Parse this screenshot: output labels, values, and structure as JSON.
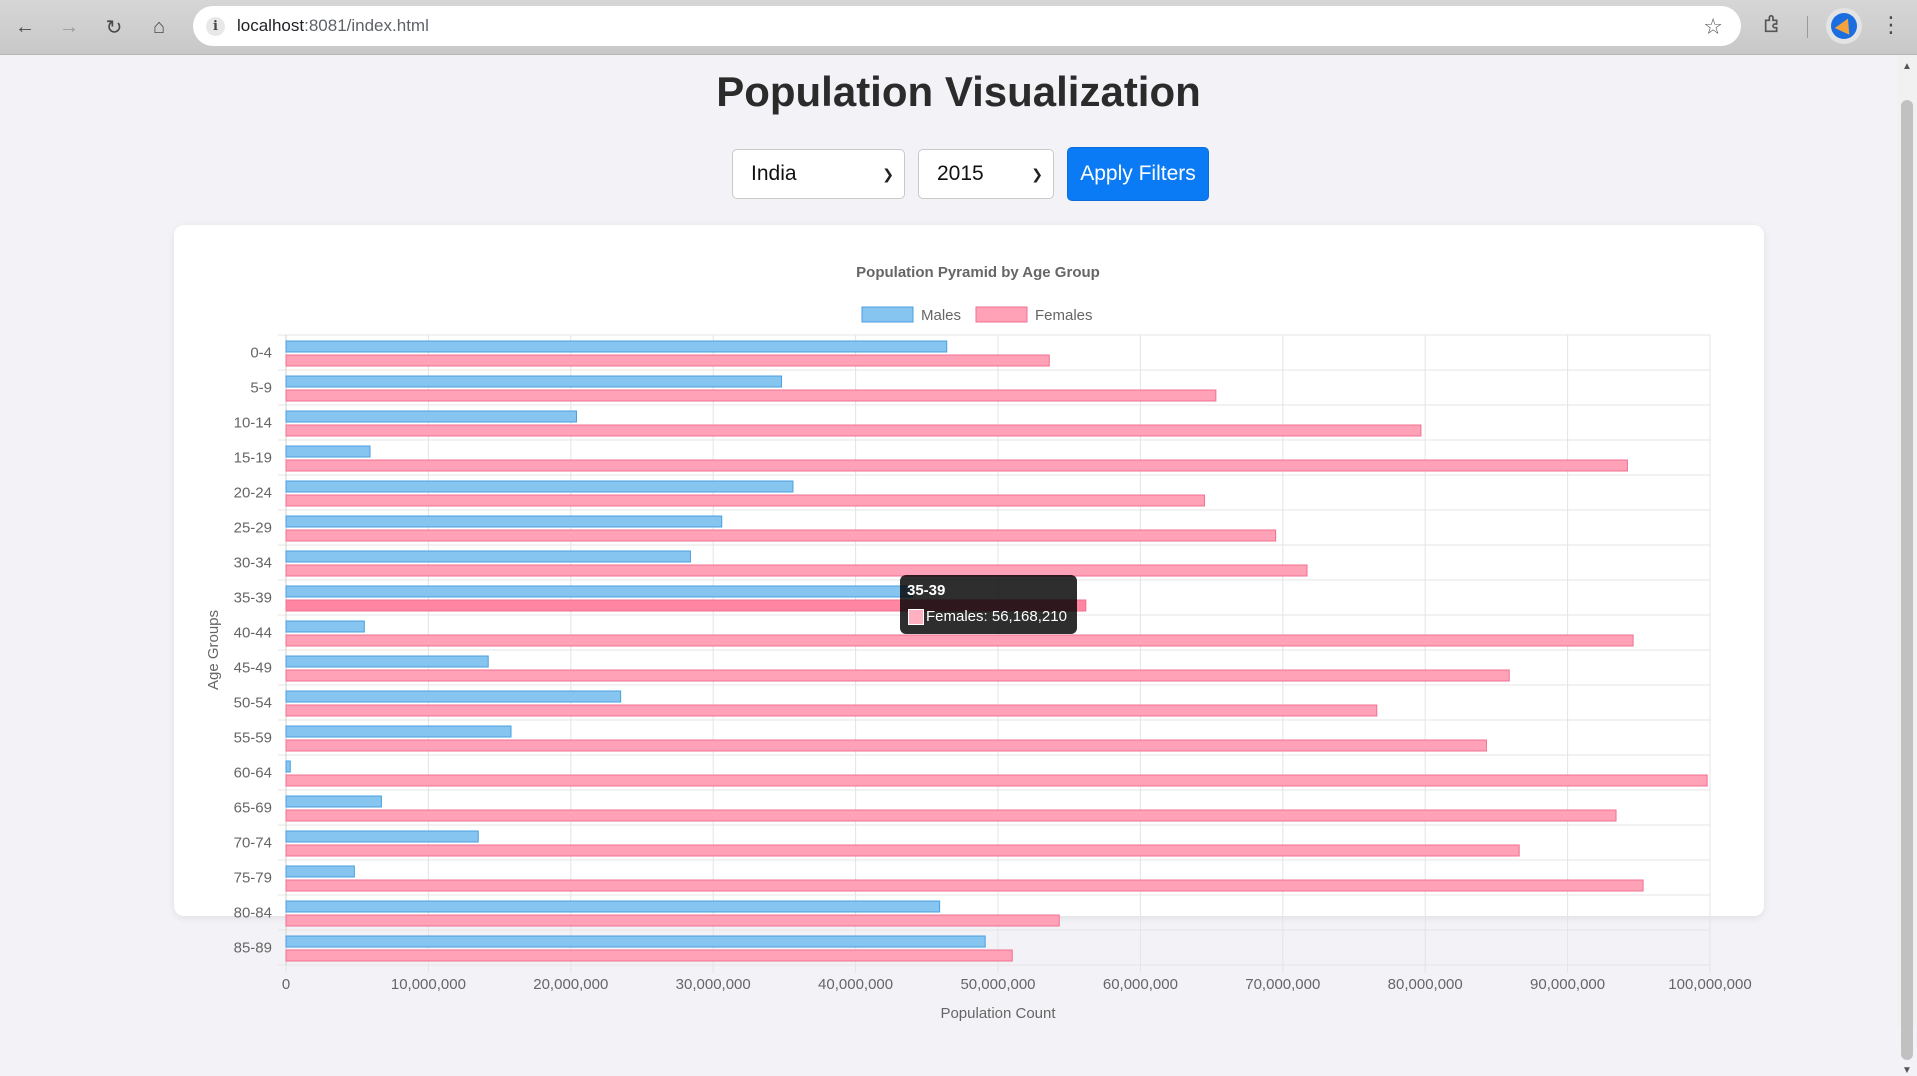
{
  "browser": {
    "url_host": "localhost",
    "url_rest": ":8081/index.html"
  },
  "page": {
    "title": "Population Visualization",
    "country_select": "India",
    "year_select": "2015",
    "apply_button": "Apply Filters"
  },
  "tooltip": {
    "title": "35-39",
    "label": "Females: 56,168,210"
  },
  "colors": {
    "males_fill": "#86c5f0",
    "males_border": "#4a9fe0",
    "females_fill": "#ffa2b8",
    "females_border": "#f0708f",
    "accent_button": "#0a7bf5"
  },
  "chart_data": {
    "type": "bar",
    "orientation": "horizontal",
    "title": "Population Pyramid by Age Group",
    "xlabel": "Population Count",
    "ylabel": "Age Groups",
    "xlim": [
      0,
      100000000
    ],
    "x_ticks": [
      "0",
      "10,000,000",
      "20,000,000",
      "30,000,000",
      "40,000,000",
      "50,000,000",
      "60,000,000",
      "70,000,000",
      "80,000,000",
      "90,000,000",
      "100,000,000"
    ],
    "legend_position": "top",
    "grid": true,
    "categories": [
      "0-4",
      "5-9",
      "10-14",
      "15-19",
      "20-24",
      "25-29",
      "30-34",
      "35-39",
      "40-44",
      "45-49",
      "50-54",
      "55-59",
      "60-64",
      "65-69",
      "70-74",
      "75-79",
      "80-84",
      "85-89"
    ],
    "series": [
      {
        "name": "Males",
        "values": [
          46400000,
          34800000,
          20400000,
          5900000,
          35600000,
          30600000,
          28400000,
          44000000,
          5500000,
          14200000,
          23500000,
          15800000,
          300000,
          6700000,
          13500000,
          4800000,
          45900000,
          49100000
        ]
      },
      {
        "name": "Females",
        "values": [
          53600000,
          65300000,
          79700000,
          94200000,
          64500000,
          69500000,
          71700000,
          56168210,
          94600000,
          85900000,
          76600000,
          84300000,
          99800000,
          93400000,
          86600000,
          95300000,
          54300000,
          51000000
        ]
      }
    ]
  }
}
